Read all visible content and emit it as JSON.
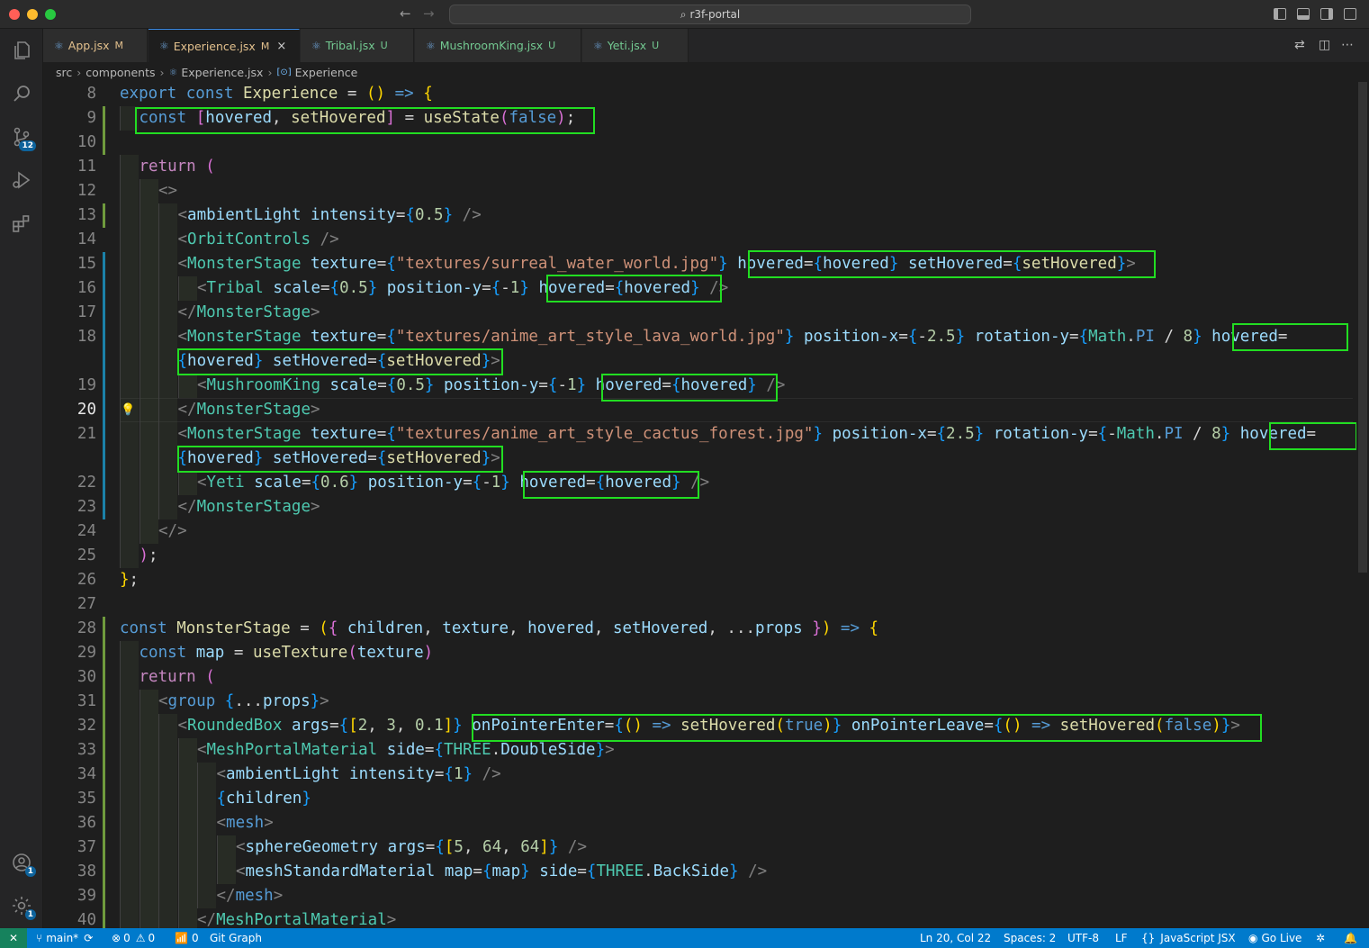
{
  "title_bar": {
    "search": "r3f-portal"
  },
  "activity": {
    "scm_badge": "12",
    "accounts_badge": "1",
    "settings_badge": "1"
  },
  "tabs": [
    {
      "name": "App.jsx",
      "status": "M"
    },
    {
      "name": "Experience.jsx",
      "status": "M",
      "close": "×"
    },
    {
      "name": "Tribal.jsx",
      "status": "U"
    },
    {
      "name": "MushroomKing.jsx",
      "status": "U"
    },
    {
      "name": "Yeti.jsx",
      "status": "U"
    }
  ],
  "breadcrumb": [
    "src",
    "components",
    "Experience.jsx",
    "Experience"
  ],
  "editor": {
    "line_numbers": [
      "8",
      "9",
      "10",
      "11",
      "12",
      "13",
      "14",
      "15",
      "16",
      "17",
      "18",
      "",
      "19",
      "20",
      "21",
      "",
      "22",
      "23",
      "24",
      "25",
      "26",
      "27",
      "28",
      "29",
      "30",
      "31",
      "32",
      "33",
      "34",
      "35",
      "36",
      "37",
      "38",
      "39",
      "40"
    ],
    "current_line": "20"
  },
  "status_bar": {
    "branch": "main*",
    "errors": "0",
    "warnings": "0",
    "ports": "0",
    "git_graph": "Git Graph",
    "cursor": "Ln 20, Col 22",
    "spaces": "Spaces: 2",
    "encoding": "UTF-8",
    "eol": "LF",
    "language": "JavaScript JSX",
    "go_live": "Go Live"
  },
  "colors": {
    "accent": "#007acc",
    "remote": "#16825d",
    "highlight": "#22dd22"
  },
  "icons": [
    "explorer-icon",
    "search-icon",
    "source-control-icon",
    "run-debug-icon",
    "extensions-icon",
    "accounts-icon",
    "manage-gear-icon"
  ]
}
